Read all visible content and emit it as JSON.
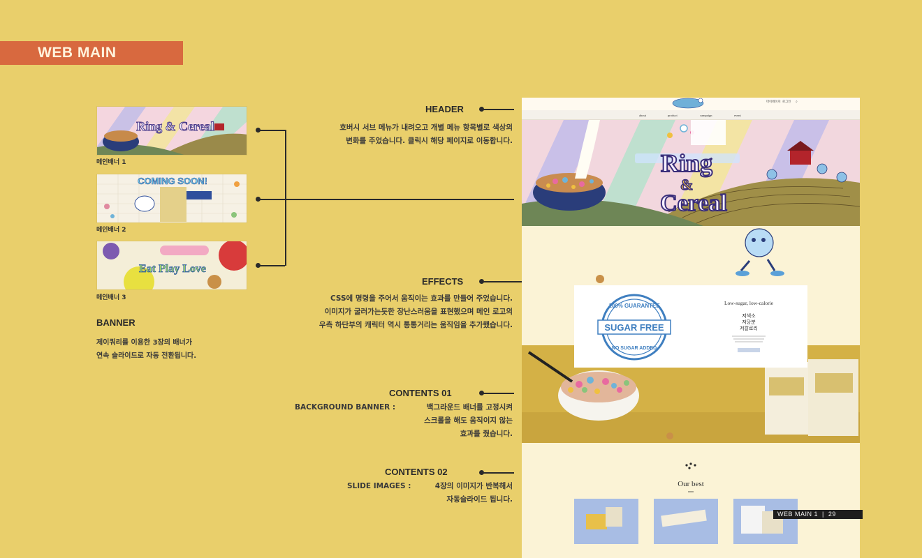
{
  "section_title": "WEB MAIN",
  "banners": [
    {
      "caption": "메인배너 1",
      "text": "Ring & Cereal"
    },
    {
      "caption": "메인배너 2",
      "text": "COMING SOON!"
    },
    {
      "caption": "메인배너 3",
      "text": "Eat Play Love"
    }
  ],
  "banner": {
    "heading": "BANNER",
    "desc_line1": "제이쿼리를 이용한 3장의 배너가",
    "desc_line2": "연속 슬라이드로 자동 전환됩니다."
  },
  "header_section": {
    "heading": "HEADER",
    "desc_line1": "호버시 서브 메뉴가 내려오고 개별 메뉴 항목별로 색상의",
    "desc_line2": "변화를 주었습니다. 클릭시 해당 페이지로 이동합니다."
  },
  "effects": {
    "heading": "EFFECTS",
    "desc_line1": "CSS에 명령을 주어서 움직이는 효과를 만들어 주었습니다.",
    "desc_line2": "이미지가 굴러가는듯한 장난스러움을 표현했으며 메인 로고의",
    "desc_line3": "우측 하단부의 캐릭터 역시 통통거리는 움직임을 추가했습니다."
  },
  "contents01": {
    "heading": "CONTENTS 01",
    "label": "BACKGROUND BANNER :",
    "desc_line1": "백그라운드 배너를 고정시켜",
    "desc_line2": "스크롤을 해도 움직이지 않는",
    "desc_line3": "효과를 줬습니다."
  },
  "contents02": {
    "heading": "CONTENTS 02",
    "label": "SLIDE IMAGES :",
    "desc_line1": "4장의 이미지가 반복해서",
    "desc_line2": "자동슬라이드 됩니다."
  },
  "site": {
    "nav_items": [
      "about",
      "product",
      "campaign",
      "event"
    ],
    "header_links": [
      "마이페이지",
      "로그인"
    ],
    "hero_line1": "Ring",
    "hero_amp": "&",
    "hero_line2": "Cereal",
    "popup_stamp_top": "100% GUARANTEE",
    "popup_stamp_mid": "SUGAR FREE",
    "popup_stamp_bottom": "NO SUGAR ADDED",
    "popup_title": "Low-sugar, low-calorie",
    "popup_k1": "저색소",
    "popup_k2": "저당분",
    "popup_k3": "저칼로리",
    "best_title": "Our best"
  },
  "footer": {
    "label": "WEB MAIN 1",
    "page": "29"
  },
  "colors": {
    "background": "#e9cf6b",
    "tab": "#d8693f",
    "site_bg": "#fbf3d6"
  }
}
